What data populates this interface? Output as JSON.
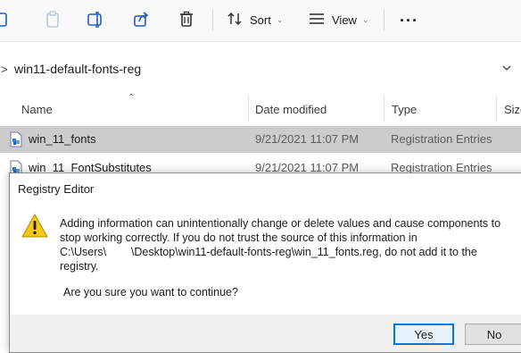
{
  "toolbar": {
    "sort_label": "Sort",
    "view_label": "View",
    "more_label": "···",
    "icons": [
      "copy-icon",
      "paste-icon",
      "rename-icon",
      "share-icon",
      "delete-icon",
      "sort-icon",
      "view-icon",
      "chevron-down-icon"
    ]
  },
  "address": {
    "separator": ">",
    "path": "win11-default-fonts-reg"
  },
  "columns": {
    "name": "Name",
    "date_modified": "Date modified",
    "type": "Type",
    "size": "Size"
  },
  "files": [
    {
      "name": "win_11_fonts",
      "date": "9/21/2021 11:07 PM",
      "type": "Registration Entries",
      "selected": true
    },
    {
      "name": "win_11_FontSubstitutes",
      "date": "9/21/2021 11:07 PM",
      "type": "Registration Entries",
      "selected": false
    }
  ],
  "dialog": {
    "title": "Registry Editor",
    "message_lines": [
      "Adding information can unintentionally change or delete values and cause components to",
      "stop working correctly. If you do not trust the source of this information in",
      "C:\\Users\\        \\Desktop\\win11-default-fonts-reg\\win_11_fonts.reg, do not add it to the",
      "registry."
    ],
    "confirm": "Are you sure you want to continue?",
    "yes_label": "Yes",
    "no_label": "No"
  },
  "colors": {
    "accent": "#0078d7",
    "warning": "#f9c80e",
    "selected_row": "#cccccc"
  }
}
